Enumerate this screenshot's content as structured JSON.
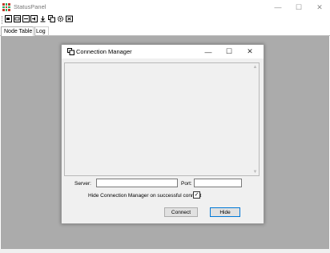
{
  "app": {
    "title": "StatusPanel",
    "controls": {
      "minimize": "—",
      "maximize": "☐",
      "close": "✕"
    }
  },
  "toolbar": {
    "buttons": [
      {
        "name": "connect-icon"
      },
      {
        "name": "image-icon"
      },
      {
        "name": "window-icon"
      },
      {
        "name": "speaker-icon"
      },
      {
        "name": "download-icon"
      },
      {
        "name": "copy-icon"
      },
      {
        "name": "settings-icon"
      },
      {
        "name": "export-icon"
      }
    ]
  },
  "tabs": [
    {
      "label": "Node Table",
      "active": true
    },
    {
      "label": "Log",
      "active": false
    }
  ],
  "dialog": {
    "title": "Connection Manager",
    "controls": {
      "minimize": "—",
      "maximize": "☐",
      "close": "✕"
    },
    "server_label": "Server:",
    "server_value": "",
    "port_label": "Port:",
    "port_value": "",
    "hide_checkbox_label": "Hide Connection Manager on successful connect",
    "hide_checkbox_checked": true,
    "hide_checkbox_mark": "✓",
    "connect_button": "Connect",
    "hide_button": "Hide"
  },
  "colors": {
    "workarea": "#ababab",
    "focus_border": "#0078d7"
  }
}
